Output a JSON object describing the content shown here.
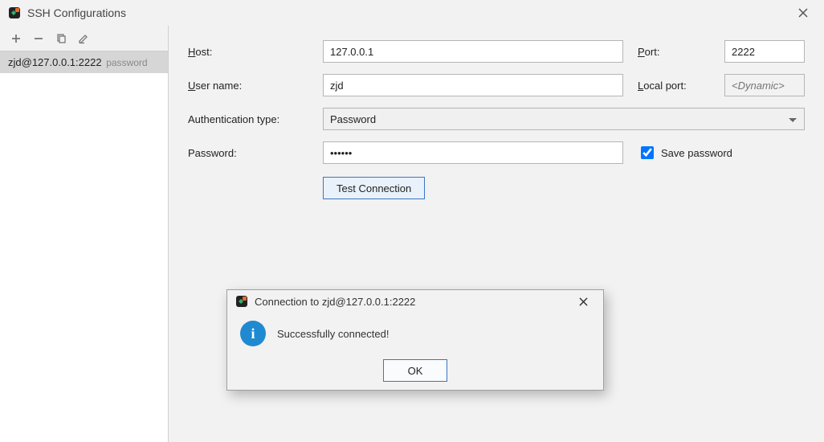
{
  "window": {
    "title": "SSH Configurations"
  },
  "sidebar": {
    "selected": {
      "label": "zjd@127.0.0.1:2222",
      "sublabel": "password"
    }
  },
  "form": {
    "host_label": "Host:",
    "host_value": "127.0.0.1",
    "port_label": "Port:",
    "port_value": "2222",
    "user_label": "User name:",
    "user_value": "zjd",
    "localport_label": "Local port:",
    "localport_placeholder": "<Dynamic>",
    "auth_label": "Authentication type:",
    "auth_value": "Password",
    "password_label": "Password:",
    "password_value": "••••••",
    "save_password_label": "Save password",
    "save_password_checked": true,
    "test_connection_label": "Test Connection"
  },
  "dialog": {
    "title": "Connection to zjd@127.0.0.1:2222",
    "message": "Successfully connected!",
    "ok_label": "OK"
  }
}
